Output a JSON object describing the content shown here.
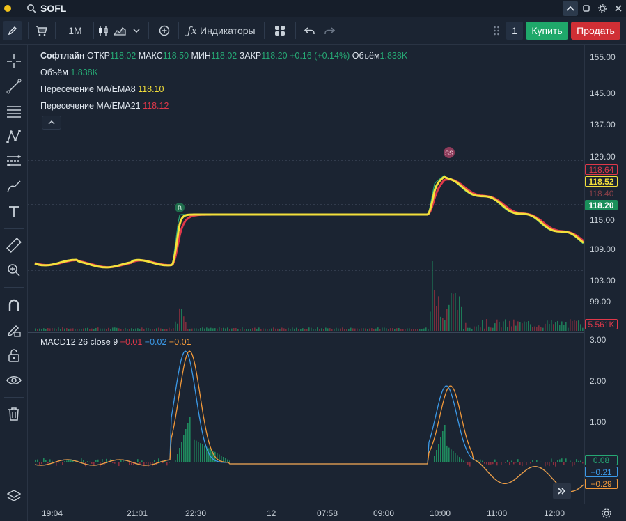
{
  "titlebar": {
    "symbol": "SOFL"
  },
  "toolbar": {
    "interval": "1M",
    "indicators_label": "Индикаторы",
    "quantity": "1",
    "buy_label": "Купить",
    "sell_label": "Продать"
  },
  "legend": {
    "name": "Софтлайн",
    "open_label": "ОТКР",
    "open": "118.02",
    "high_label": "МАКС",
    "high": "118.50",
    "low_label": "МИН",
    "low": "118.02",
    "close_label": "ЗАКР",
    "close": "118.20",
    "change": "+0.16 (+0.14%)",
    "volume_label": "Объём",
    "volume": "1.838K",
    "volume_row_label": "Объём",
    "volume_row_value": "1.838K",
    "ma8_label": "Пересечение MA/EMA8",
    "ma8_value": "118.10",
    "ma21_label": "Пересечение MA/EMA21",
    "ma21_value": "118.12",
    "macd_label": "MACD12 26 close 9",
    "macd_hist": "−0.01",
    "macd_line": "−0.02",
    "macd_signal": "−0.01"
  },
  "price_axis": [
    "155.00",
    "145.00",
    "137.00",
    "129.00",
    "115.00",
    "109.00",
    "103.00",
    "99.00"
  ],
  "price_tags": {
    "ma21": "118.64",
    "ma8": "118.52",
    "prev": "118.40",
    "last": "118.20",
    "volume": "5.561K"
  },
  "macd_axis": [
    "3.00",
    "2.00",
    "1.00"
  ],
  "macd_tags": {
    "hist": "0.08",
    "macd": "−0.21",
    "signal": "−0.29"
  },
  "time_axis": [
    "19:04",
    "21:01",
    "22:30",
    "12",
    "07:58",
    "09:00",
    "10:00",
    "11:00",
    "12:00"
  ],
  "markers": {
    "buy": "B",
    "sell": "SS"
  },
  "colors": {
    "price_line": "#26a874",
    "ema8": "#f3e03b",
    "ema21": "#e0384a",
    "macd": "#3c9ae8",
    "signal": "#f2993a",
    "buy": "#1fa86a",
    "sell": "#d02f35"
  }
}
